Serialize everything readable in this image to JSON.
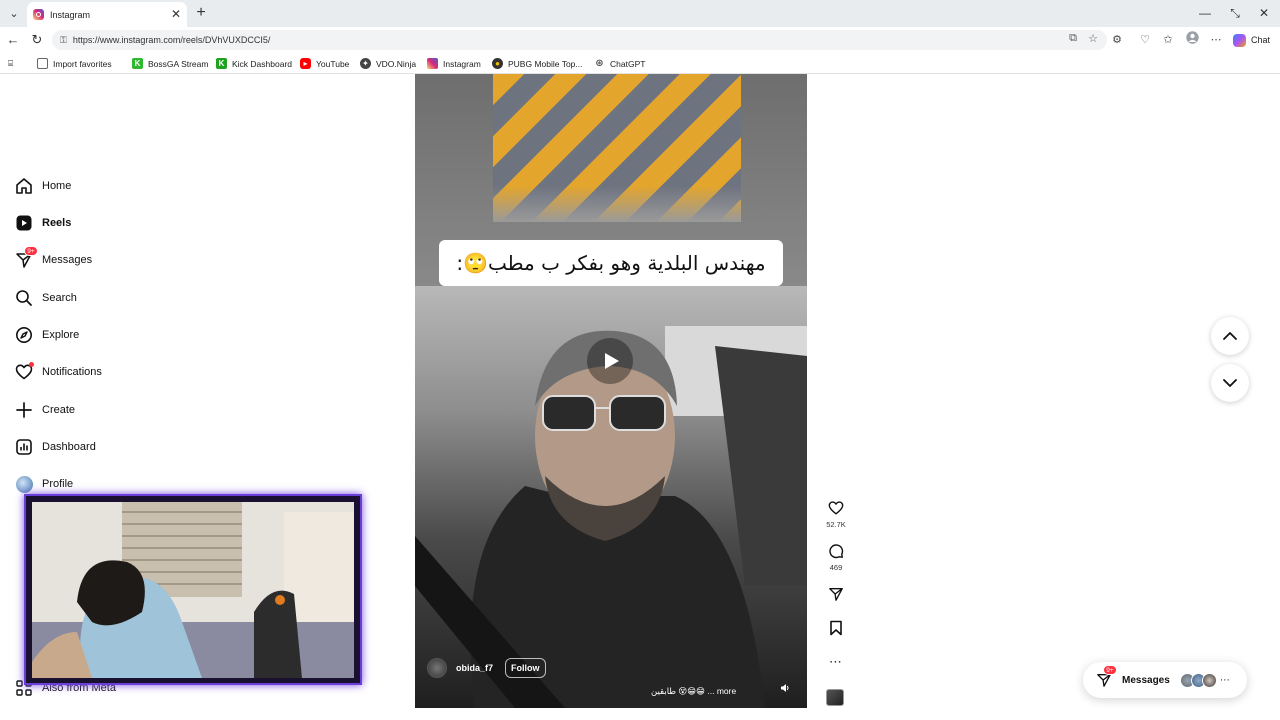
{
  "browser": {
    "tab_title": "Instagram",
    "url": "https://www.instagram.com/reels/DVhVUXDCCI5/",
    "chat_label": "Chat",
    "bookmarks": [
      {
        "label": "Import favorites",
        "color": "#666666"
      },
      {
        "label": "BossGA Stream",
        "color": "#2eb82e"
      },
      {
        "label": "Kick Dashboard",
        "color": "#1fa31f"
      },
      {
        "label": "YouTube",
        "color": "#ff0000"
      },
      {
        "label": "VDO.Ninja",
        "color": "#444444"
      },
      {
        "label": "Instagram",
        "color": "#d62976"
      },
      {
        "label": "PUBG Mobile Top...",
        "color": "#333333"
      },
      {
        "label": "ChatGPT",
        "color": "#777777"
      }
    ]
  },
  "nav": {
    "items": [
      {
        "label": "Home",
        "icon": "home-icon"
      },
      {
        "label": "Reels",
        "icon": "reels-icon",
        "active": true
      },
      {
        "label": "Messages",
        "icon": "messages-icon",
        "badge": "9+"
      },
      {
        "label": "Search",
        "icon": "search-icon"
      },
      {
        "label": "Explore",
        "icon": "explore-icon"
      },
      {
        "label": "Notifications",
        "icon": "heart-icon"
      },
      {
        "label": "Create",
        "icon": "plus-icon"
      },
      {
        "label": "Dashboard",
        "icon": "dashboard-icon"
      },
      {
        "label": "Profile",
        "icon": "avatar"
      }
    ],
    "also_from_meta": "Also from Meta"
  },
  "reel": {
    "overlay_caption": "مهندس البلدية وهو بفكر ب مطب🙄:",
    "author": "obida_f7",
    "follow_label": "Follow",
    "caption_preview": "طابقين 😵😁😁 ... more",
    "likes": "52.7K",
    "comments": "469"
  },
  "messages_pill": {
    "label": "Messages",
    "badge": "9+"
  },
  "colors": {
    "notification_red": "#ff3040",
    "webcam_border": "#6a3fd8"
  }
}
